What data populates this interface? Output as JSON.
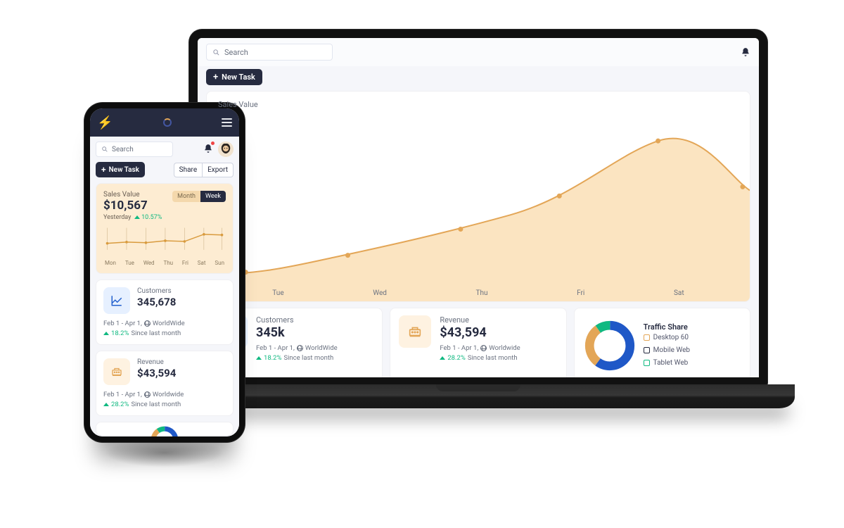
{
  "search_placeholder": "Search",
  "new_task_label": "New Task",
  "laptop": {
    "sales": {
      "title": "Sales Value",
      "xlabels": [
        "Tue",
        "Wed",
        "Thu",
        "Fri",
        "Sat"
      ]
    },
    "customers": {
      "label": "Customers",
      "value": "345k",
      "daterange": "Feb 1 - Apr 1,",
      "scope": "WorldWide",
      "trend_pct": "18.2%",
      "trend_note": "Since last month"
    },
    "revenue": {
      "label": "Revenue",
      "value": "$43,594",
      "daterange": "Feb 1 - Apr 1,",
      "scope": "Worldwide",
      "trend_pct": "28.2%",
      "trend_note": "Since last month"
    },
    "traffic": {
      "title": "Traffic Share",
      "items": [
        {
          "label": "Desktop 60",
          "color": "#e3a657"
        },
        {
          "label": "Mobile Web",
          "color": "#262b40"
        },
        {
          "label": "Tablet Web",
          "color": "#10b981"
        }
      ]
    }
  },
  "phone": {
    "sales": {
      "title": "Sales Value",
      "value": "$10,567",
      "sublabel": "Yesterday",
      "trend_pct": "10.57%",
      "toggle": {
        "month": "Month",
        "week": "Week"
      },
      "days": [
        "Mon",
        "Tue",
        "Wed",
        "Thu",
        "Fri",
        "Sat",
        "Sun"
      ]
    },
    "buttons": {
      "share": "Share",
      "export": "Export"
    },
    "customers": {
      "label": "Customers",
      "value": "345,678",
      "daterange": "Feb 1 - Apr 1,",
      "scope": "WorldWide",
      "trend_pct": "18.2%",
      "trend_note": "Since last month"
    },
    "revenue": {
      "label": "Revenue",
      "value": "$43,594",
      "daterange": "Feb 1 - Apr 1,",
      "scope": "Worldwide",
      "trend_pct": "28.2%",
      "trend_note": "Since last month"
    }
  },
  "chart_data": [
    {
      "type": "line",
      "name": "Laptop Sales Value",
      "categories": [
        "Tue",
        "Wed",
        "Thu",
        "Fri",
        "Sat"
      ],
      "values": [
        18,
        30,
        45,
        82,
        62
      ],
      "ylim": [
        0,
        100
      ]
    },
    {
      "type": "line",
      "name": "Phone Sales Value (Week)",
      "categories": [
        "Mon",
        "Tue",
        "Wed",
        "Thu",
        "Fri",
        "Sat",
        "Sun"
      ],
      "values": [
        40,
        44,
        41,
        48,
        47,
        70,
        68
      ],
      "ylim": [
        0,
        100
      ]
    },
    {
      "type": "pie",
      "name": "Traffic Share",
      "series": [
        {
          "name": "Desktop",
          "value": 60,
          "color": "#1f58c7"
        },
        {
          "name": "Mobile Web",
          "value": 30,
          "color": "#e3a657"
        },
        {
          "name": "Tablet Web",
          "value": 10,
          "color": "#10b981"
        }
      ]
    }
  ]
}
